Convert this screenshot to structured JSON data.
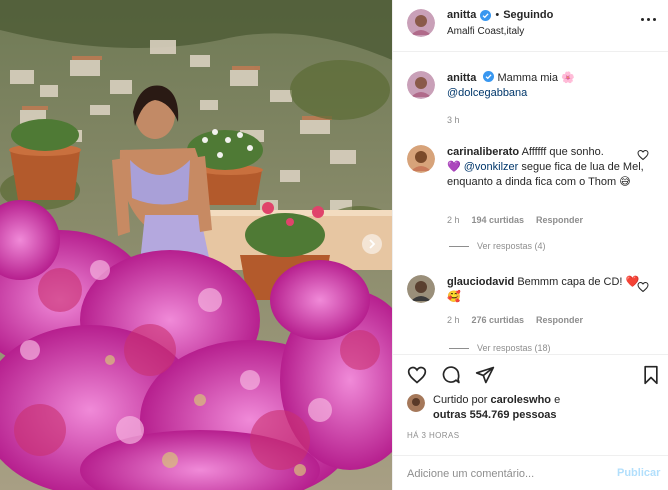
{
  "post": {
    "author": "anitta",
    "follow_label": "Seguindo",
    "separator": "•",
    "location": "Amalfi Coast,italy"
  },
  "caption": {
    "username": "anitta",
    "text": "Mamma mia",
    "emoji": "🌸",
    "mention": "@dolcegabbana",
    "time": "3 h"
  },
  "comments": [
    {
      "username": "carinaliberato",
      "text_before": "Affffff que sonho.",
      "emoji1": "💜",
      "mention": "@vonkilzer",
      "text_after": "segue fica de lua de Mel, enquanto a dinda fica com o Thom",
      "emoji2": "😅",
      "time": "2 h",
      "likes": "194 curtidas",
      "reply_label": "Responder",
      "view_replies": "Ver respostas (4)"
    },
    {
      "username": "glauciodavid",
      "text": "Bemmm capa de CD!",
      "emoji1": "❤️",
      "emoji2": "🥰",
      "time": "2 h",
      "likes": "276 curtidas",
      "reply_label": "Responder",
      "view_replies": "Ver respostas (18)"
    }
  ],
  "likes_summary": {
    "prefix": "Curtido por",
    "user": "caroleswho",
    "connector": "e",
    "others": "outras 554.769 pessoas"
  },
  "time_ago": "HÁ 3 HORAS",
  "comment_box": {
    "placeholder": "Adicione um comentário...",
    "publish_label": "Publicar"
  },
  "icons": {
    "verified": "verified-badge-icon",
    "more": "more-options-icon",
    "heart": "heart-icon",
    "comment": "comment-icon",
    "share": "share-icon",
    "save": "bookmark-icon",
    "carousel": "chevron-right-icon"
  },
  "colors": {
    "verified_blue": "#3897f0",
    "link": "#00376b",
    "muted": "#8e8e8e",
    "publish_disabled": "#b2dffc"
  }
}
